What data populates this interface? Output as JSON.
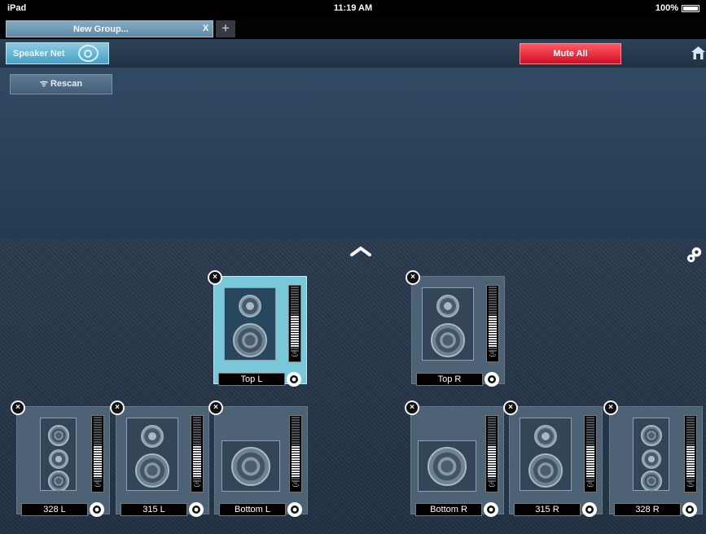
{
  "status_bar": {
    "device": "iPad",
    "time": "11:19 AM",
    "battery": "100%"
  },
  "tabs": [
    {
      "label": "New Group...",
      "close": "X"
    }
  ],
  "toolbar": {
    "speaker_net": "Speaker Net",
    "mute_all": "Mute All",
    "home_icon": "home-icon"
  },
  "upper": {
    "rescan": "Rescan"
  },
  "speakers": [
    {
      "label": "Top L",
      "kind": "bookshelf",
      "selected": true
    },
    {
      "label": "Top R",
      "kind": "bookshelf",
      "selected": false
    },
    {
      "label": "328 L",
      "kind": "tower",
      "selected": false
    },
    {
      "label": "315 L",
      "kind": "bookshelf",
      "selected": false
    },
    {
      "label": "Bottom L",
      "kind": "sub",
      "selected": false
    },
    {
      "label": "Bottom R",
      "kind": "sub",
      "selected": false
    },
    {
      "label": "315 R",
      "kind": "bookshelf",
      "selected": false
    },
    {
      "label": "328 R",
      "kind": "tower",
      "selected": false
    }
  ],
  "colors": {
    "accent": "#45a1c6",
    "mute": "#d10f24",
    "selected_tile": "#79c8da"
  }
}
